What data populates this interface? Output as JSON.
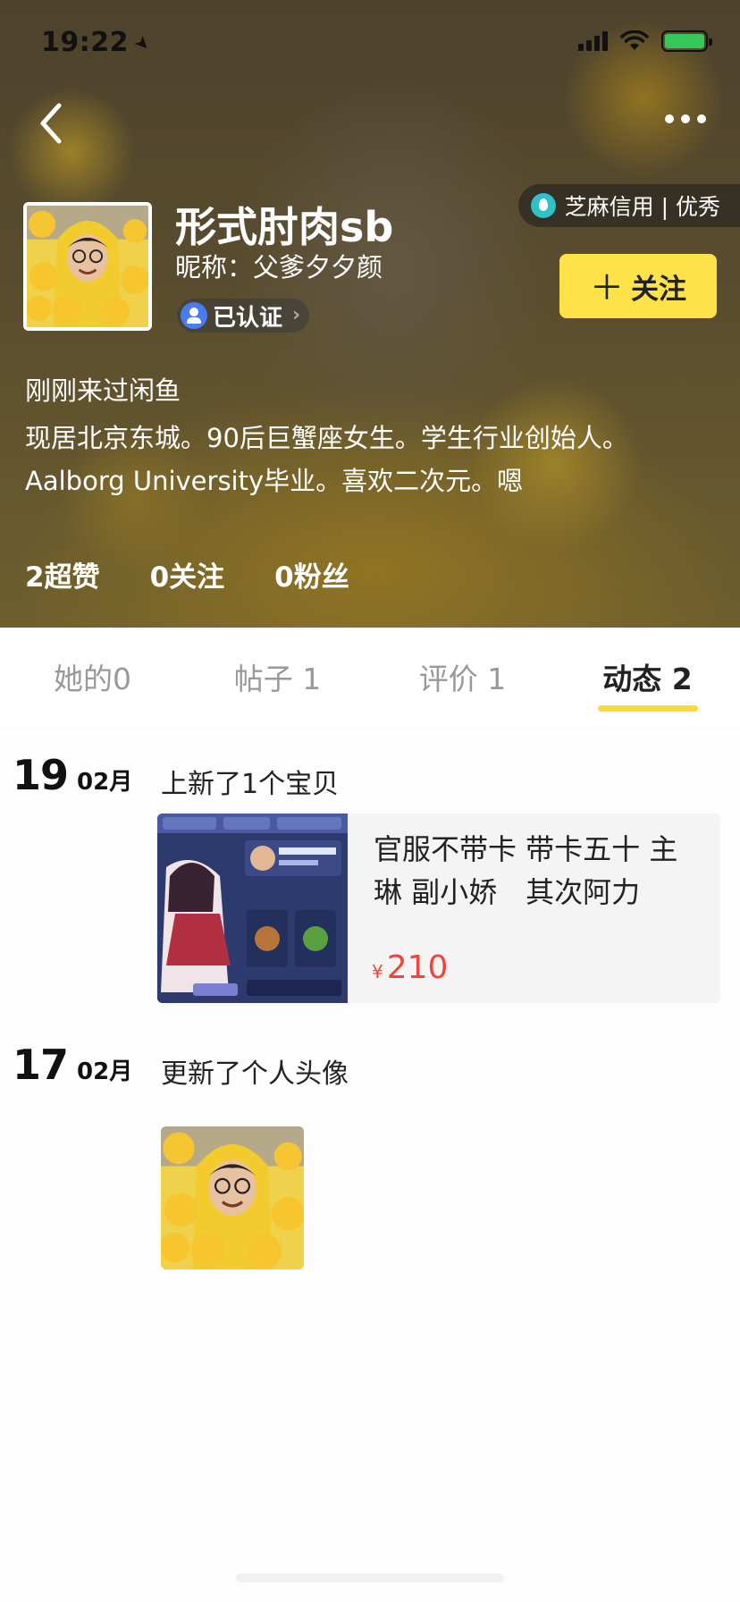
{
  "status_bar": {
    "time": "19:22"
  },
  "header": {
    "sesame_credit": "芝麻信用 | 优秀",
    "profile_name": "形式肘肉sb",
    "nickname": "昵称：父爹夕夕颜",
    "verified": "已认证",
    "follow_label": "关注",
    "recent_visit": "刚刚来过闲鱼",
    "bio": "现居北京东城。90后巨蟹座女生。学生行业创始人。Aalborg University毕业。喜欢二次元。嗯"
  },
  "stats": {
    "likes": "2超赞",
    "following": "0关注",
    "followers": "0粉丝"
  },
  "tabs": [
    {
      "label": "她的0"
    },
    {
      "label": "帖子 1"
    },
    {
      "label": "评价 1"
    },
    {
      "label": "动态 2"
    }
  ],
  "feed": [
    {
      "day": "19",
      "month": "02月",
      "action": "上新了1个宝贝",
      "item": {
        "title": "官服不带卡 带卡五十 主琳 副小娇　其次阿力",
        "currency": "¥",
        "price": "210"
      }
    },
    {
      "day": "17",
      "month": "02月",
      "action": "更新了个人头像"
    }
  ],
  "colors": {
    "accent": "#ffe14a",
    "price": "#f0453b",
    "tab_indicator": "#ffd93a"
  }
}
